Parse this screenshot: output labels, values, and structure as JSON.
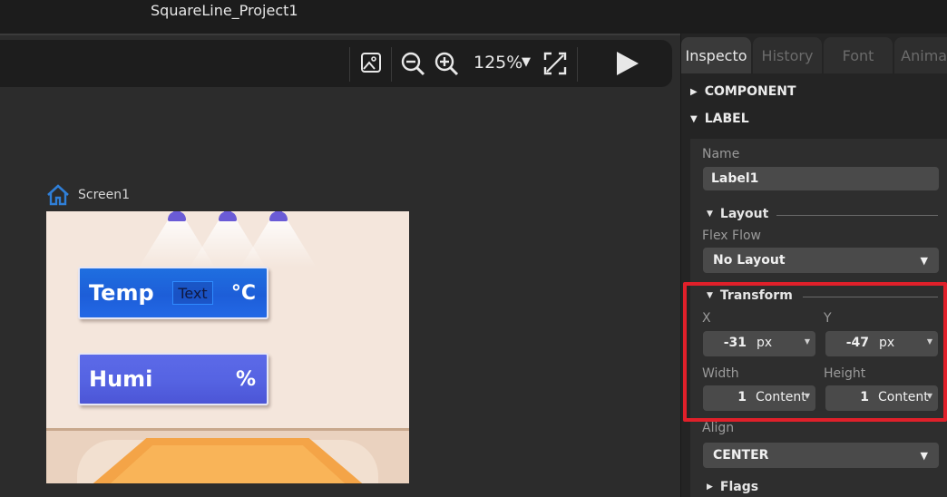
{
  "window": {
    "title": "SquareLine_Project1"
  },
  "toolbar": {
    "zoom_value": "125%",
    "zoom_caret": "▼"
  },
  "canvas": {
    "breadcrumb": "Screen1",
    "screen": {
      "temp_card": {
        "caption": "Temp",
        "value": "Text",
        "unit": "°C"
      },
      "humi_card": {
        "caption": "Humi",
        "unit": "%"
      }
    }
  },
  "inspector": {
    "tabs": [
      "Inspecto",
      "History",
      "Font",
      "Animati"
    ],
    "sections": {
      "component": "COMPONENT",
      "label": "LABEL"
    },
    "name": {
      "label": "Name",
      "value": "Label1"
    },
    "layout": {
      "title": "Layout",
      "flex_flow_label": "Flex Flow",
      "flex_flow_value": "No Layout"
    },
    "transform": {
      "title": "Transform",
      "x_label": "X",
      "x_value": "-31",
      "x_unit": "px",
      "y_label": "Y",
      "y_value": "-47",
      "y_unit": "px",
      "width_label": "Width",
      "width_value": "1",
      "width_unit": "Content",
      "height_label": "Height",
      "height_value": "1",
      "height_unit": "Content"
    },
    "align": {
      "label": "Align",
      "value": "CENTER"
    },
    "flags": {
      "title": "Flags"
    }
  },
  "colors": {
    "highlight": "#e0202a",
    "home_icon": "#2f7fd8",
    "temp_card": "#1f6fe0",
    "humi_card": "#5c6ae8"
  }
}
